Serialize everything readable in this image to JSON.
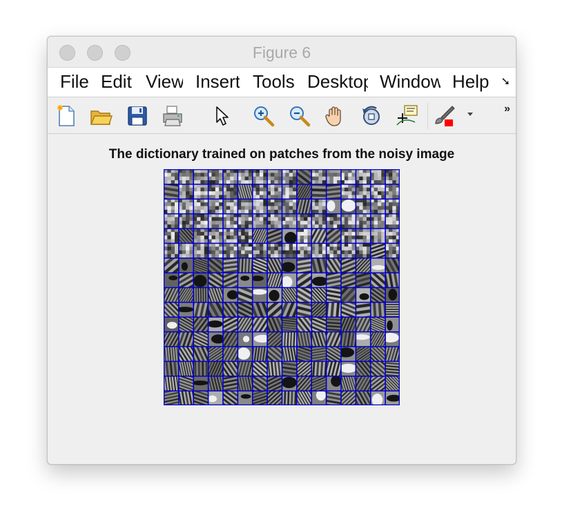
{
  "window": {
    "title": "Figure 6",
    "controls": [
      "close",
      "minimize",
      "zoom"
    ]
  },
  "menubar": {
    "items": [
      "File",
      "Edit",
      "View",
      "Insert",
      "Tools",
      "Desktop",
      "Window",
      "Help"
    ],
    "overflow_icon": "overflow-arrow-icon"
  },
  "toolbar": {
    "buttons": [
      {
        "name": "new-figure",
        "icon": "new-document-icon"
      },
      {
        "name": "open-file",
        "icon": "folder-open-icon"
      },
      {
        "name": "save-figure",
        "icon": "floppy-disk-icon"
      },
      {
        "name": "print-figure",
        "icon": "printer-icon"
      },
      {
        "name": "edit-plot",
        "icon": "pointer-arrow-icon"
      },
      {
        "name": "zoom-in",
        "icon": "zoom-in-icon"
      },
      {
        "name": "zoom-out",
        "icon": "zoom-out-icon"
      },
      {
        "name": "pan",
        "icon": "hand-icon"
      },
      {
        "name": "rotate-3d",
        "icon": "rotate-icon"
      },
      {
        "name": "data-cursor",
        "icon": "data-tip-icon"
      },
      {
        "name": "brush",
        "icon": "brush-icon"
      }
    ],
    "more_label": "»"
  },
  "plot": {
    "title": "The dictionary trained on patches from the noisy image",
    "grid_rows": 16,
    "grid_cols": 16,
    "border_color": "#0000d0"
  }
}
